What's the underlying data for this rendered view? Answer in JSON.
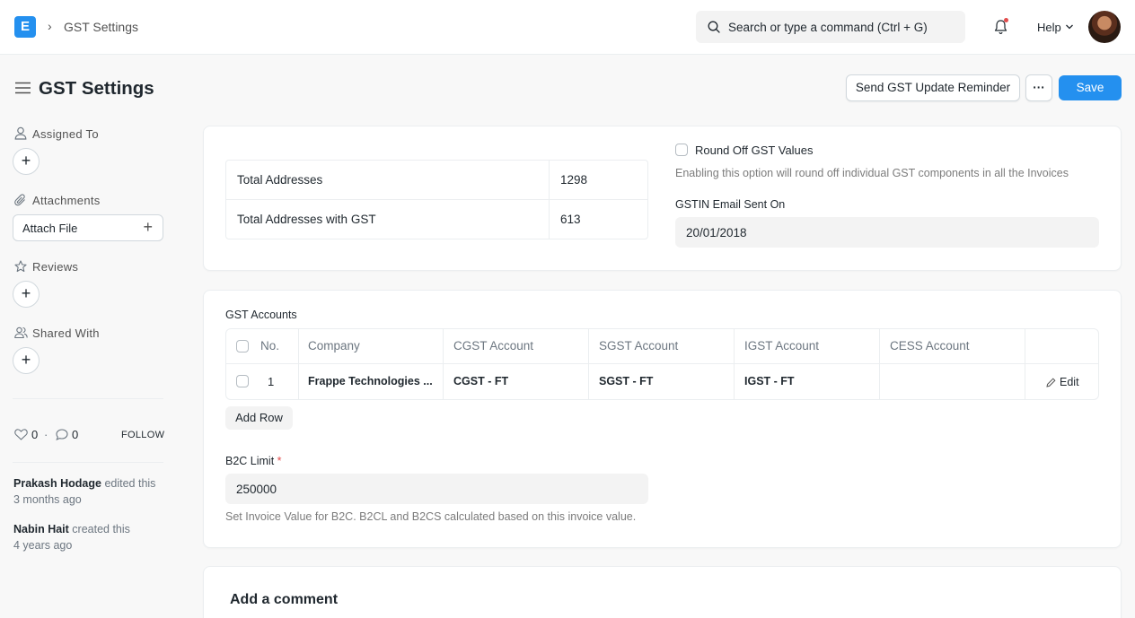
{
  "navbar": {
    "logo_letter": "E",
    "breadcrumb": "GST Settings",
    "search_placeholder": "Search or type a command (Ctrl + G)",
    "help_label": "Help"
  },
  "page": {
    "title": "GST Settings",
    "send_reminder_label": "Send GST Update Reminder",
    "more_label": "···",
    "save_label": "Save"
  },
  "sidebar": {
    "assigned_to": "Assigned To",
    "attachments": "Attachments",
    "attach_file": "Attach File",
    "reviews": "Reviews",
    "shared_with": "Shared With",
    "likes": "0",
    "dot": "·",
    "comments": "0",
    "follow": "FOLLOW",
    "activity": [
      {
        "user": "Prakash Hodage",
        "action": " edited this",
        "time": "3 months ago"
      },
      {
        "user": "Nabin Hait",
        "action": " created this",
        "time": "4 years ago"
      }
    ]
  },
  "stats": {
    "total_addresses_label": "Total Addresses",
    "total_addresses_value": "1298",
    "total_with_gst_label": "Total Addresses with GST",
    "total_with_gst_value": "613"
  },
  "round_off": {
    "label": "Round Off GST Values",
    "help": "Enabling this option will round off individual GST components in all the Invoices"
  },
  "gstin_email": {
    "label": "GSTIN Email Sent On",
    "value": "20/01/2018"
  },
  "gst_accounts": {
    "label": "GST Accounts",
    "columns": [
      "No.",
      "Company",
      "CGST Account",
      "SGST Account",
      "IGST Account",
      "CESS Account"
    ],
    "rows": [
      {
        "no": "1",
        "company": "Frappe Technologies ...",
        "cgst": "CGST - FT",
        "sgst": "SGST - FT",
        "igst": "IGST - FT",
        "cess": "",
        "edit": "Edit"
      }
    ],
    "add_row": "Add Row"
  },
  "b2c": {
    "label": "B2C Limit",
    "required_mark": "*",
    "value": "250000",
    "help": "Set Invoice Value for B2C. B2CL and B2CS calculated based on this invoice value."
  },
  "comment": {
    "title": "Add a comment"
  }
}
